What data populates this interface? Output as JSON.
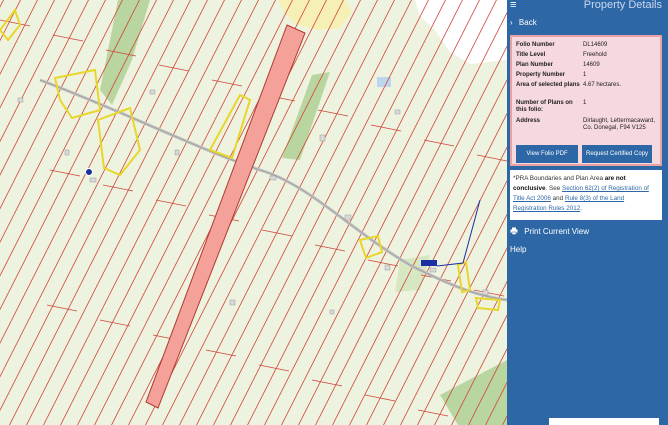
{
  "panel": {
    "title": "Property Details",
    "menu_glyph": "≡",
    "back_label": "Back",
    "back_glyph": "›",
    "details": [
      {
        "key": "Folio Number",
        "value": "DL14609"
      },
      {
        "key": "Title Level",
        "value": "Freehold"
      },
      {
        "key": "Plan Number",
        "value": "14609"
      },
      {
        "key": "Property Number",
        "value": "1"
      },
      {
        "key": "Area of selected plans",
        "value": "4.67 hectares."
      },
      {
        "key": "Number of Plans on this folio:",
        "value": "1"
      },
      {
        "key": "Address",
        "value": "Dirlaught, Lettermacaward, Co. Donegal, F94 V125"
      }
    ],
    "view_pdf_label": "View Folio PDF",
    "request_copy_label": "Request Certified Copy",
    "note": {
      "prefix": "*PRA Boundaries and Plan Area",
      "bold": "are not conclusive",
      "see": ". See",
      "link1": "Section 62(2) of Registration of Title Act 2006",
      "and": "and",
      "link2": "Rule 8(3) of the Land Registration Rules 2012",
      "suffix": "."
    },
    "print_label": "Print Current View",
    "print_icon": "printer-icon",
    "help_label": "Help"
  },
  "colors": {
    "panel_bg": "#2e67a6",
    "details_bg": "#f6d8df",
    "details_border": "#e8a2a4",
    "map_bg": "#eef3df",
    "boundary": "#d0453a",
    "selected_plot": "#f4a19a",
    "yellow_plot": "#e8d62a",
    "woodland": "#b9d6a0",
    "water_area": "#f7f0b5",
    "marker": "#1a2fa3"
  }
}
